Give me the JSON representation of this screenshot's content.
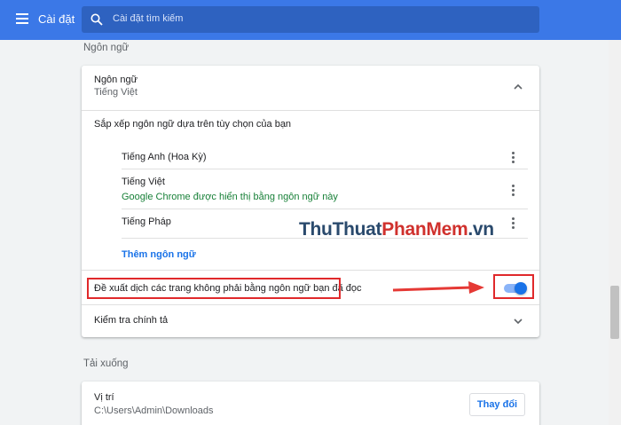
{
  "header": {
    "title": "Cài đặt",
    "search_placeholder": "Cài đặt tìm kiếm"
  },
  "languages_section": {
    "title": "Ngôn ngữ",
    "card": {
      "heading": "Ngôn ngữ",
      "current_language": "Tiếng Việt",
      "order_hint": "Sắp xếp ngôn ngữ dựa trên tùy chọn của bạn",
      "items": [
        {
          "name": "Tiếng Anh (Hoa Kỳ)",
          "note": ""
        },
        {
          "name": "Tiếng Việt",
          "note": "Google Chrome được hiển thị bằng ngôn ngữ này"
        },
        {
          "name": "Tiếng Pháp",
          "note": ""
        }
      ],
      "add_language": "Thêm ngôn ngữ",
      "translate_offer": "Đề xuất dịch các trang không phải bằng ngôn ngữ bạn đã đọc",
      "translate_offer_enabled": true,
      "spellcheck": "Kiểm tra chính tả"
    }
  },
  "downloads_section": {
    "title": "Tải xuống",
    "location_label": "Vị trí",
    "location_path": "C:\\Users\\Admin\\Downloads",
    "change_button": "Thay đổi"
  },
  "watermark": {
    "part1": "ThuThuat",
    "part2": "PhanMem",
    "part3": ".vn"
  },
  "colors": {
    "header": "#3b78e7",
    "accent": "#1a73e8",
    "chrome_note": "#188038",
    "highlight": "#e0292b"
  }
}
